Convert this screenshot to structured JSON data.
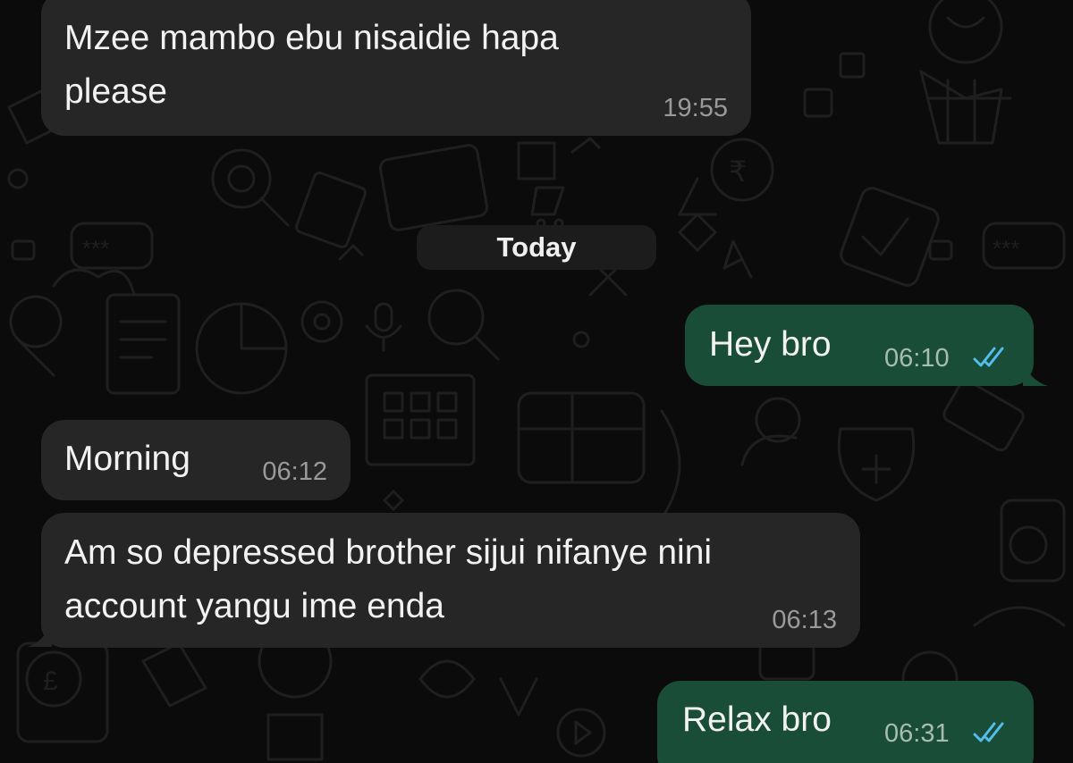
{
  "date_separator": "Today",
  "messages": [
    {
      "direction": "in",
      "text_lines": [
        "Mzee mambo ebu nisaidie hapa",
        "please"
      ],
      "time": "19:55"
    },
    {
      "direction": "out",
      "text_lines": [
        "Hey bro"
      ],
      "time": "06:10",
      "status": "double-check-read"
    },
    {
      "direction": "in",
      "text_lines": [
        "Morning"
      ],
      "time": "06:12"
    },
    {
      "direction": "in",
      "text_lines": [
        "Am so depressed brother sijui nifanye nini",
        "account yangu ime enda"
      ],
      "time": "06:13"
    },
    {
      "direction": "out",
      "text_lines": [
        "Relax bro"
      ],
      "time": "06:31",
      "status": "double-check-read"
    }
  ],
  "colors": {
    "background": "#0b0b0b",
    "incoming_bubble": "#262626",
    "outgoing_bubble": "#1a4d38",
    "read_ticks": "#53bdeb",
    "timestamp": "#9a9a9a"
  }
}
